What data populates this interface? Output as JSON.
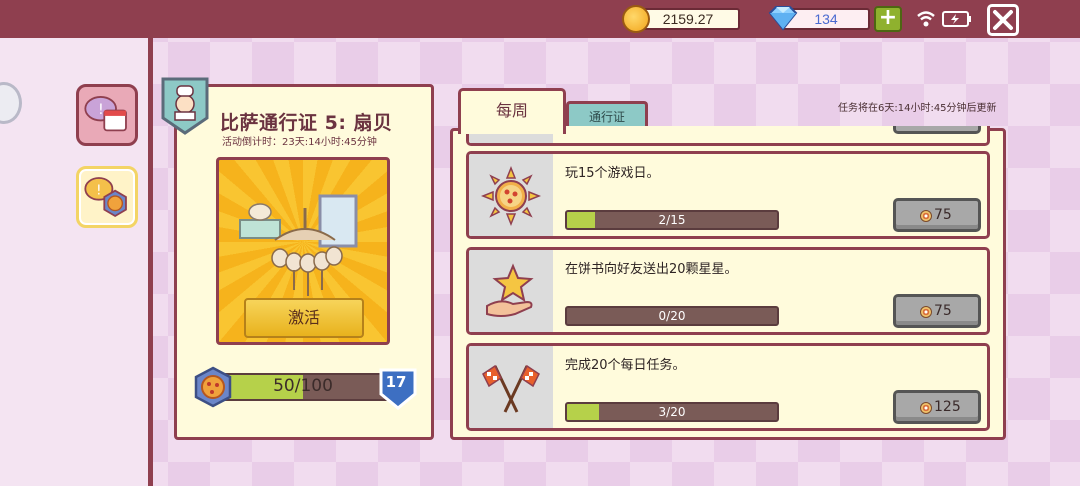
{
  "topbar": {
    "coins": "2159.27",
    "gems": "134",
    "plus_label": "+",
    "close_label": "✕"
  },
  "pass": {
    "title": "比萨通行证 5: 扇贝",
    "countdown": "活动倒计时：23天:14小时:45分钟",
    "activate_label": "激活",
    "xp_current": "50",
    "xp_max": "100",
    "xp_progress": 0.5,
    "level": "17"
  },
  "tabs": {
    "weekly": "每周",
    "pass": "通行证"
  },
  "refresh_note": "任务将在6天:14小时:45分钟后更新",
  "quests": [
    {
      "desc": "玩15个游戏日。",
      "progress_text": "2/15",
      "progress": 0.133,
      "reward": "75",
      "icon": "sun-pizza-icon"
    },
    {
      "desc": "在饼书向好友送出20颗星星。",
      "progress_text": "0/20",
      "progress": 0.0,
      "reward": "75",
      "icon": "star-hand-icon"
    },
    {
      "desc": "完成20个每日任务。",
      "progress_text": "3/20",
      "progress": 0.15,
      "reward": "125",
      "icon": "checkered-flags-icon"
    }
  ],
  "colors": {
    "frame": "#8f3f4f",
    "panel": "#fffbdc",
    "progress_fill": "#b6d14a",
    "progress_track": "#7a5b57"
  }
}
